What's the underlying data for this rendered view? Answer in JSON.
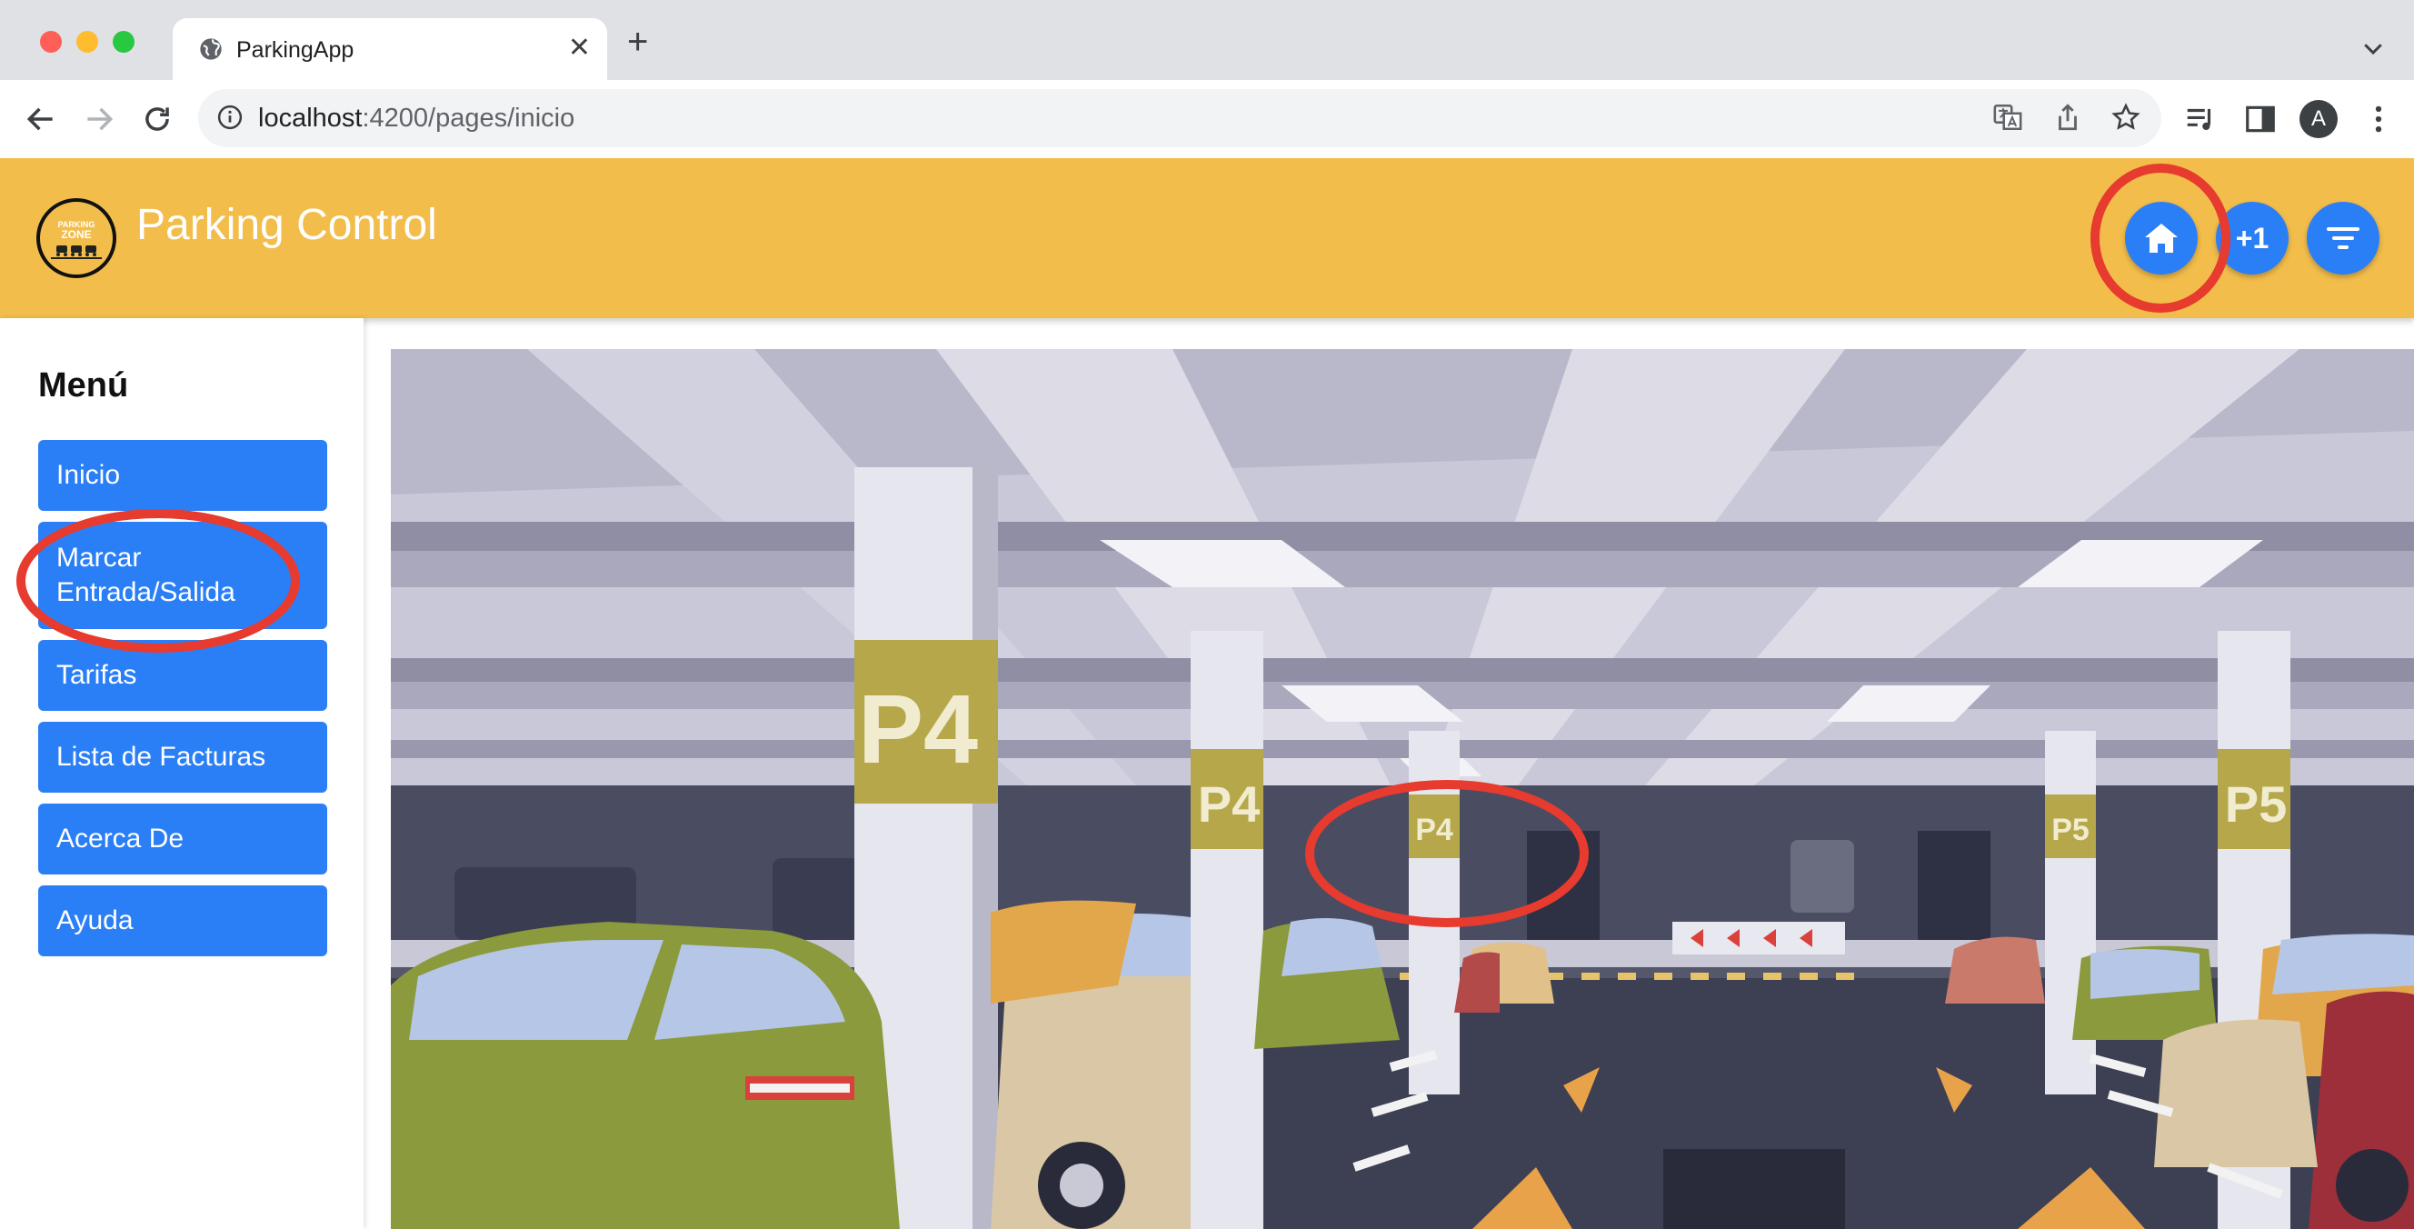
{
  "browser": {
    "tab_title": "ParkingApp",
    "url_host": "localhost",
    "url_path": ":4200/pages/inicio",
    "avatar_letter": "A",
    "icons": [
      "globe-icon",
      "close-icon",
      "plus-icon",
      "back-icon",
      "forward-icon",
      "reload-icon",
      "info-icon",
      "translate-icon",
      "share-icon",
      "star-icon",
      "reading-list-icon",
      "side-panel-icon",
      "kebab-menu-icon",
      "chevron-down-icon"
    ]
  },
  "header": {
    "title": "Parking Control",
    "logo_text": [
      "PARKING",
      "ZONE"
    ],
    "fab_plus_label": "+1",
    "background": "#f2bd4b",
    "fab_color": "#2b7ff6"
  },
  "sidebar": {
    "title": "Menú",
    "items": [
      {
        "label": "Inicio"
      },
      {
        "label": "Marcar Entrada/Salida"
      },
      {
        "label": "Tarifas"
      },
      {
        "label": "Lista de Facturas"
      },
      {
        "label": "Acerca De"
      },
      {
        "label": "Ayuda"
      }
    ]
  },
  "hero": {
    "signs": [
      "P4",
      "P4",
      "P4",
      "P5",
      "P5"
    ]
  },
  "annotations": {
    "color": "#e63b2e"
  }
}
